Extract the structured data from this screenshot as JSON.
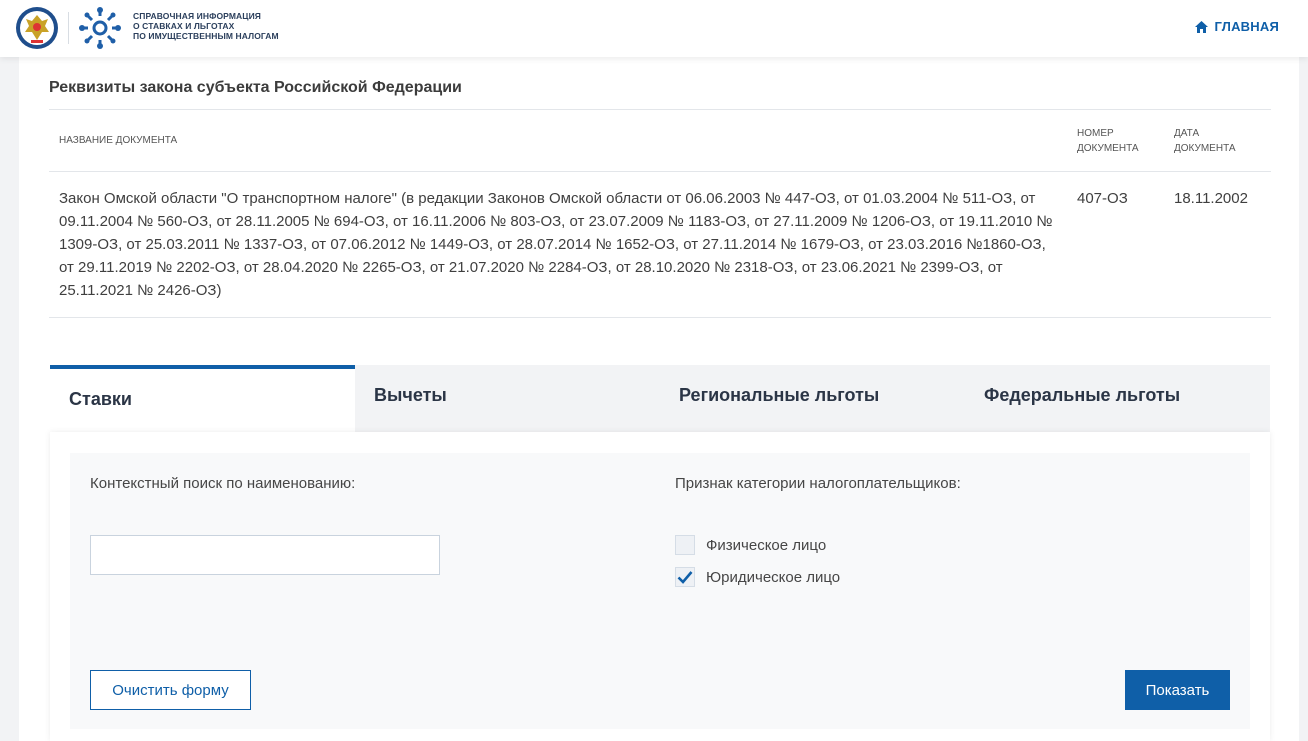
{
  "header": {
    "logo_lines": [
      "Справочная информация",
      "о ставках и льготах",
      "по имущественным налогам"
    ],
    "home_label": "ГЛАВНАЯ"
  },
  "law": {
    "section_title": "Реквизиты закона субъекта Российской Федерации",
    "columns": {
      "name": "НАЗВАНИЕ ДОКУМЕНТА",
      "number": "НОМЕР ДОКУМЕНТА",
      "date": "ДАТА ДОКУМЕНТА"
    },
    "row": {
      "name": "Закон Омской области \"О транспортном налоге\" (в редакции Законов Омской области от 06.06.2003 № 447-ОЗ, от 01.03.2004 № 511-ОЗ, от 09.11.2004 № 560-ОЗ, от 28.11.2005 № 694-ОЗ, от 16.11.2006 № 803-ОЗ, от 23.07.2009 № 1183-ОЗ, от 27.11.2009 № 1206-ОЗ, от 19.11.2010 № 1309-ОЗ, от 25.03.2011 № 1337-ОЗ, от 07.06.2012 № 1449-ОЗ, от 28.07.2014 № 1652-ОЗ, от 27.11.2014 № 1679-ОЗ, от 23.03.2016 №1860-ОЗ, от 29.11.2019 № 2202-ОЗ, от 28.04.2020 № 2265-ОЗ, от 21.07.2020 № 2284-ОЗ, от 28.10.2020 № 2318-ОЗ, от 23.06.2021 № 2399-ОЗ, от 25.11.2021 № 2426-ОЗ)",
      "number": "407-ОЗ",
      "date": "18.11.2002"
    }
  },
  "tabs": [
    {
      "label": "Ставки",
      "active": true
    },
    {
      "label": "Вычеты",
      "active": false
    },
    {
      "label": "Региональные льготы",
      "active": false
    },
    {
      "label": "Федеральные льготы",
      "active": false
    }
  ],
  "filter": {
    "search_label": "Контекстный поиск по наименованию:",
    "search_value": "",
    "search_placeholder": "",
    "category_label": "Признак категории налогоплательщиков:",
    "checkboxes": [
      {
        "label": "Физическое лицо",
        "checked": false
      },
      {
        "label": "Юридическое лицо",
        "checked": true
      }
    ],
    "clear_label": "Очистить форму",
    "show_label": "Показать"
  },
  "colors": {
    "accent": "#0f5fa8",
    "background": "#f2f3f5",
    "panel": "#f8f9fa"
  }
}
